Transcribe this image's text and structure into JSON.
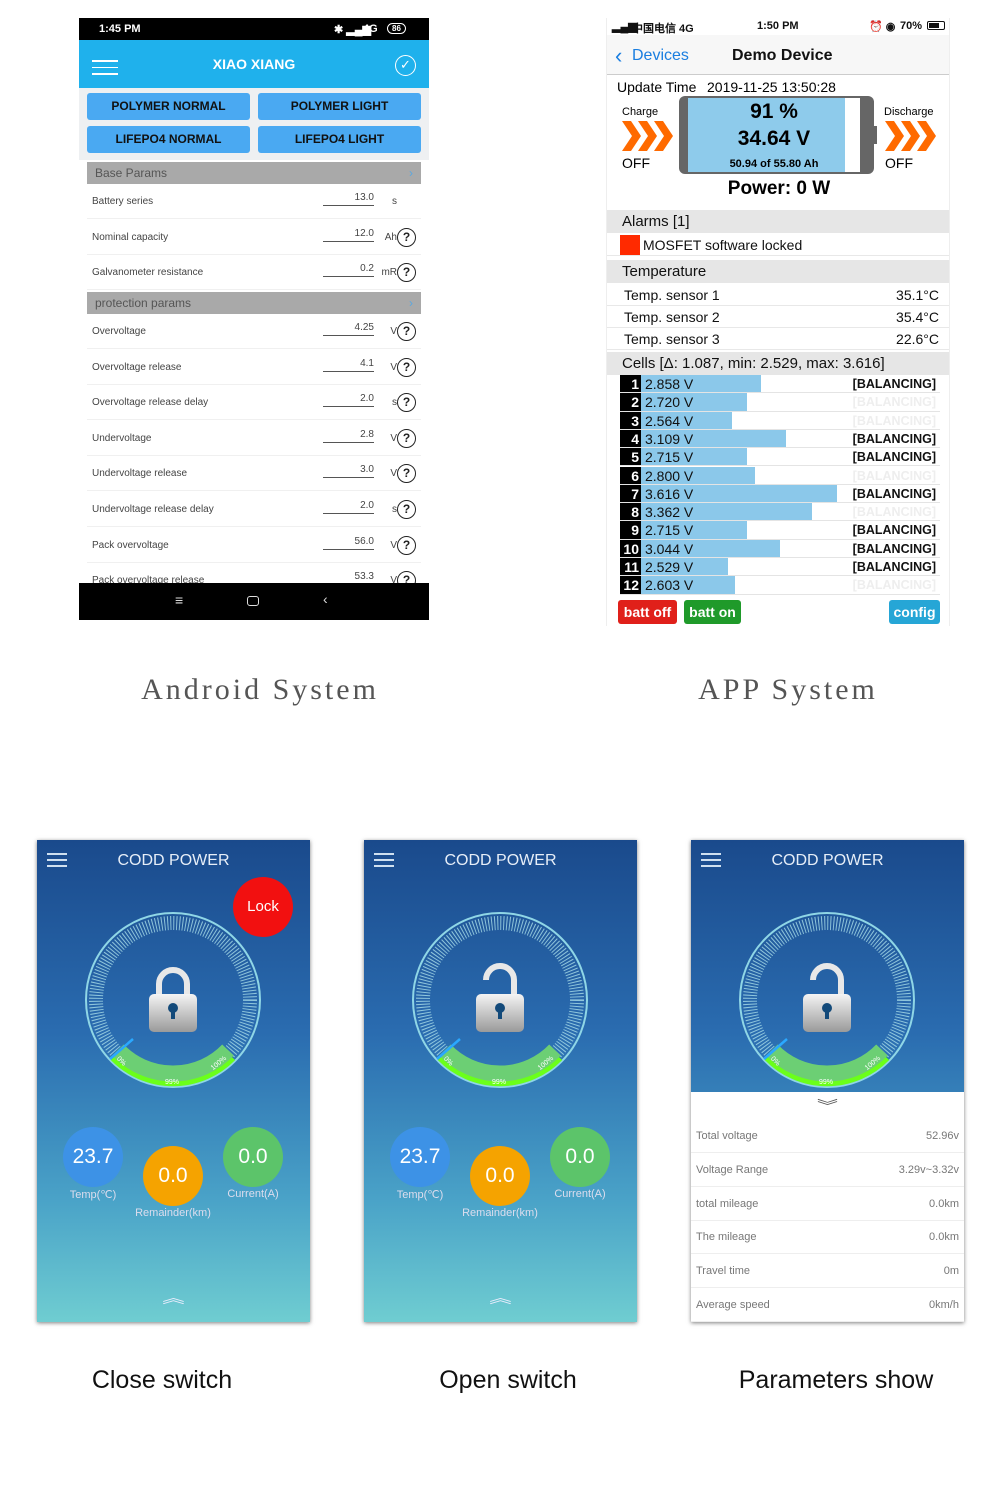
{
  "android": {
    "status": {
      "time": "1:45 PM",
      "right": "4G",
      "battery": "86"
    },
    "header_title": "XIAO XIANG",
    "buttons": [
      "POLYMER NORMAL",
      "POLYMER LIGHT",
      "LIFEPO4 NORMAL",
      "LIFEPO4 LIGHT"
    ],
    "sections": [
      {
        "title": "Base Params",
        "rows": [
          {
            "label": "Battery series",
            "value": "13.0",
            "unit": "s",
            "help": false
          },
          {
            "label": "Nominal capacity",
            "value": "12.0",
            "unit": "Ah",
            "help": true
          },
          {
            "label": "Galvanometer resistance",
            "value": "0.2",
            "unit": "mR",
            "help": true
          }
        ]
      },
      {
        "title": "protection params",
        "rows": [
          {
            "label": "Overvoltage",
            "value": "4.25",
            "unit": "V",
            "help": true
          },
          {
            "label": "Overvoltage release",
            "value": "4.1",
            "unit": "V",
            "help": true
          },
          {
            "label": "Overvoltage release delay",
            "value": "2.0",
            "unit": "s",
            "help": true
          },
          {
            "label": "Undervoltage",
            "value": "2.8",
            "unit": "V",
            "help": true
          },
          {
            "label": "Undervoltage release",
            "value": "3.0",
            "unit": "V",
            "help": true
          },
          {
            "label": "Undervoltage release delay",
            "value": "2.0",
            "unit": "s",
            "help": true
          },
          {
            "label": "Pack overvoltage",
            "value": "56.0",
            "unit": "V",
            "help": true
          },
          {
            "label": "Pack overvoltage release",
            "value": "53.3",
            "unit": "V",
            "help": true
          }
        ]
      }
    ],
    "help_glyph": "?"
  },
  "app": {
    "status": {
      "carrier": "中国电信 4G",
      "time": "1:50 PM",
      "battery": "70%"
    },
    "nav": {
      "back": "Devices",
      "title": "Demo Device"
    },
    "update_label": "Update Time",
    "update_time": "2019-11-25 13:50:28",
    "charge": {
      "label": "Charge",
      "state": "OFF"
    },
    "discharge": {
      "label": "Discharge",
      "state": "OFF"
    },
    "battery": {
      "percent": "91 %",
      "soc": 0.91,
      "voltage": "34.64 V",
      "capacity": "50.94 of 55.80 Ah"
    },
    "power": "Power: 0 W",
    "alarms_header": "Alarms [1]",
    "alarms": [
      "MOSFET software locked"
    ],
    "alarm_color": "#ff2a00",
    "temperature_header": "Temperature",
    "temps": [
      {
        "label": "Temp. sensor 1",
        "value": "35.1°C"
      },
      {
        "label": "Temp. sensor 2",
        "value": "35.4°C"
      },
      {
        "label": "Temp. sensor 3",
        "value": "22.6°C"
      }
    ],
    "cells_header": "Cells [Δ: 1.087, min: 2.529, max: 3.616]",
    "balancing_label": "[BALANCING]",
    "cells": [
      {
        "n": "1",
        "v": 2.858,
        "text": "2.858 V",
        "balancing": true
      },
      {
        "n": "2",
        "v": 2.72,
        "text": "2.720 V",
        "balancing": false
      },
      {
        "n": "3",
        "v": 2.564,
        "text": "2.564 V",
        "balancing": false
      },
      {
        "n": "4",
        "v": 3.109,
        "text": "3.109 V",
        "balancing": true
      },
      {
        "n": "5",
        "v": 2.715,
        "text": "2.715 V",
        "balancing": true
      },
      {
        "n": "6",
        "v": 2.8,
        "text": "2.800 V",
        "balancing": false
      },
      {
        "n": "7",
        "v": 3.616,
        "text": "3.616 V",
        "balancing": true
      },
      {
        "n": "8",
        "v": 3.362,
        "text": "3.362 V",
        "balancing": false
      },
      {
        "n": "9",
        "v": 2.715,
        "text": "2.715 V",
        "balancing": true
      },
      {
        "n": "10",
        "v": 3.044,
        "text": "3.044 V",
        "balancing": true
      },
      {
        "n": "11",
        "v": 2.529,
        "text": "2.529 V",
        "balancing": true
      },
      {
        "n": "12",
        "v": 2.603,
        "text": "2.603 V",
        "balancing": false
      }
    ],
    "buttons": {
      "batt_off": "batt off",
      "batt_on": "batt on",
      "config": "config"
    },
    "colors": {
      "batt_off": "#e0201a",
      "batt_on": "#1f9a2a",
      "config": "#26a6d6",
      "cell_bar": "#8bc8ea"
    }
  },
  "captions": {
    "android": "Android System",
    "app": "APP System",
    "close": "Close switch",
    "open": "Open switch",
    "params": "Parameters show"
  },
  "phones": [
    {
      "title": "CODD POWER",
      "lock_button": "Lock",
      "locked": true,
      "gauge": {
        "min": "0%",
        "value": "99%",
        "max": "100%"
      },
      "temp": "23.7",
      "temp_label": "Temp(℃)",
      "remainder": "0.0",
      "remainder_label": "Remainder(km)",
      "current": "0.0",
      "current_label": "Current(A)"
    },
    {
      "title": "CODD POWER",
      "locked": false,
      "gauge": {
        "min": "0%",
        "value": "99%",
        "max": "100%"
      },
      "temp": "23.7",
      "temp_label": "Temp(℃)",
      "remainder": "0.0",
      "remainder_label": "Remainder(km)",
      "current": "0.0",
      "current_label": "Current(A)"
    },
    {
      "title": "CODD POWER",
      "locked": false,
      "gauge": {
        "min": "0%",
        "value": "99%",
        "max": "100%"
      },
      "params": [
        {
          "label": "Total voltage",
          "value": "52.96v"
        },
        {
          "label": "Voltage Range",
          "value": "3.29v~3.32v"
        },
        {
          "label": "total mileage",
          "value": "0.0km"
        },
        {
          "label": "The mileage",
          "value": "0.0km"
        },
        {
          "label": "Travel time",
          "value": "0m"
        },
        {
          "label": "Average speed",
          "value": "0km/h"
        }
      ]
    }
  ]
}
